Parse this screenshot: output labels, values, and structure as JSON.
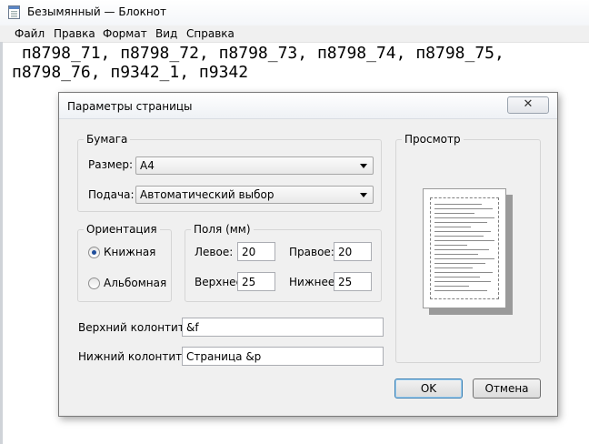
{
  "notepad": {
    "title": "Безымянный — Блокнот",
    "menu": [
      "Файл",
      "Правка",
      "Формат",
      "Вид",
      "Справка"
    ],
    "text_line1": " п8798_71, п8798_72, п8798_73, п8798_74, п8798_75,",
    "text_line2": "п8798_76, п9342_1, п9342"
  },
  "dialog": {
    "title": "Параметры страницы",
    "close_glyph": "✕",
    "paper": {
      "group_label": "Бумага",
      "size_label": "Размер:",
      "size_value": "A4",
      "source_label": "Подача:",
      "source_value": "Автоматический выбор"
    },
    "orientation": {
      "group_label": "Ориентация",
      "portrait_label": "Книжная",
      "landscape_label": "Альбомная",
      "selected": "portrait"
    },
    "margins": {
      "group_label": "Поля (мм)",
      "left_label": "Левое:",
      "left_value": "20",
      "right_label": "Правое:",
      "right_value": "20",
      "top_label": "Верхнее:",
      "top_value": "25",
      "bottom_label": "Нижнее:",
      "bottom_value": "25"
    },
    "header_label": "Верхний колонтитул:",
    "header_value": "&f",
    "footer_label": "Нижний колонтитул:",
    "footer_value": "Страница &p",
    "preview_label": "Просмотр",
    "ok_label": "OK",
    "cancel_label": "Отмена"
  },
  "colors": {
    "dialog_background": "#f0f0f0",
    "radio_selected": "#1f4e9c",
    "default_button_border": "#3c7fb1"
  }
}
